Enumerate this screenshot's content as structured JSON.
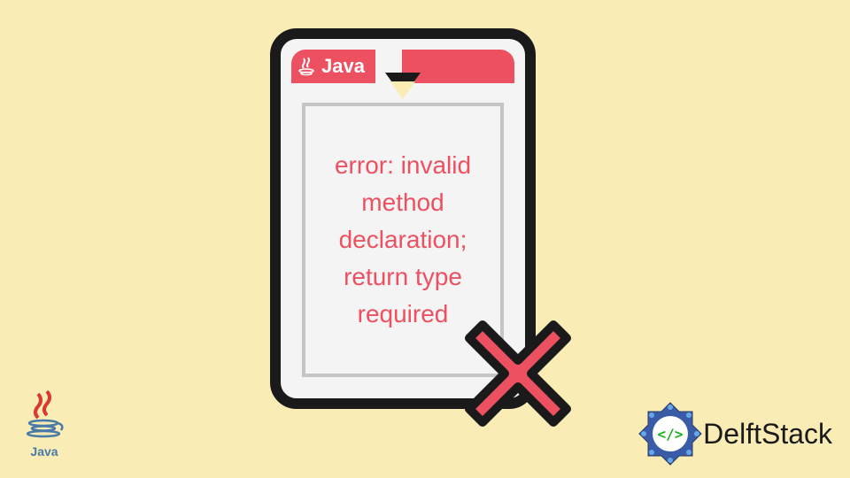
{
  "header": {
    "java_label": "Java"
  },
  "document": {
    "error_text": "error: invalid method declaration; return type required"
  },
  "corner": {
    "java_label": "Java"
  },
  "brand": {
    "name": "DelftStack"
  }
}
